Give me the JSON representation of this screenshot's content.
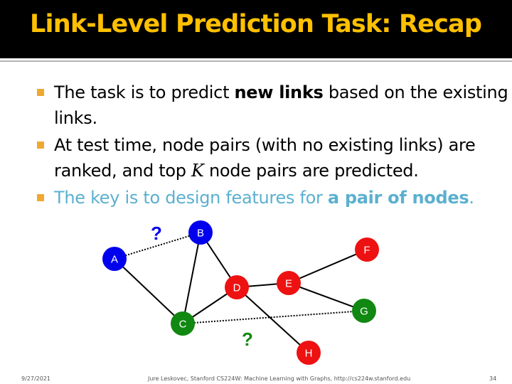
{
  "slide": {
    "title": "Link-Level Prediction Task: Recap",
    "bullets": [
      {
        "before": "The task is to predict ",
        "bold": "new links",
        "after": " based on the existing links."
      },
      {
        "before": "At test time, node pairs (with no existing links) are ranked, and top ",
        "variable": "K",
        "after": " node pairs are predicted."
      },
      {
        "before": "The key is to design features for ",
        "bold": "a pair of nodes",
        "after": "."
      }
    ],
    "footer": {
      "date": "9/27/2021",
      "credit": "Jure Leskovec, Stanford CS224W: Machine Learning with Graphs, http://cs224w.stanford.edu",
      "page": "34"
    }
  },
  "graph": {
    "nodes": [
      {
        "id": "A",
        "color": "#0000ee"
      },
      {
        "id": "B",
        "color": "#0000ee"
      },
      {
        "id": "C",
        "color": "#118811"
      },
      {
        "id": "D",
        "color": "#ee1111"
      },
      {
        "id": "E",
        "color": "#ee1111"
      },
      {
        "id": "F",
        "color": "#ee1111"
      },
      {
        "id": "G",
        "color": "#118811"
      },
      {
        "id": "H",
        "color": "#ee1111"
      }
    ],
    "edges": [
      [
        "A",
        "C"
      ],
      [
        "B",
        "C"
      ],
      [
        "B",
        "D"
      ],
      [
        "C",
        "D"
      ],
      [
        "D",
        "E"
      ],
      [
        "E",
        "F"
      ],
      [
        "E",
        "G"
      ],
      [
        "D",
        "H"
      ]
    ],
    "predicted_links": [
      {
        "from": "A",
        "to": "B",
        "mark": "?",
        "mark_color": "#0000ee"
      },
      {
        "from": "C",
        "to": "G",
        "mark": "?",
        "mark_color": "#118811"
      }
    ]
  }
}
